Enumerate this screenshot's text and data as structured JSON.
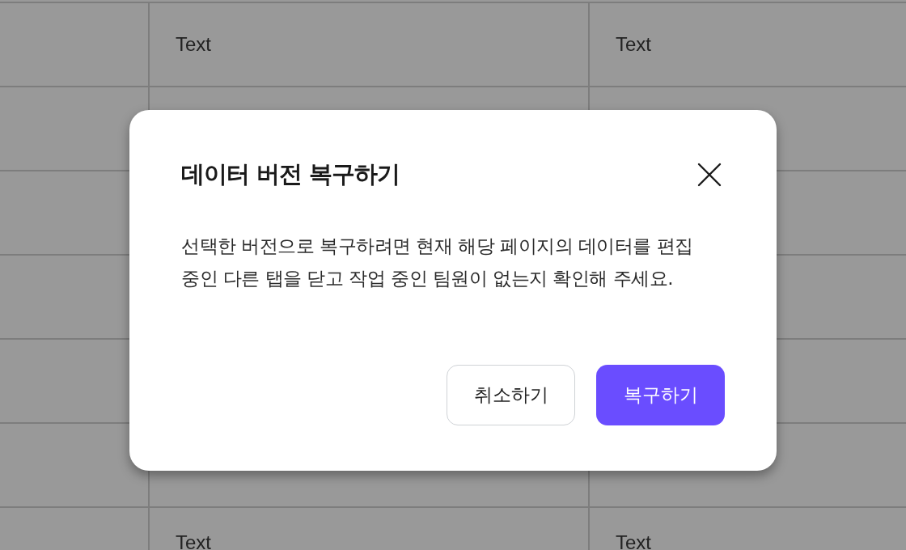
{
  "table": {
    "rows": [
      {
        "kind": "text",
        "column_2": "Text",
        "column_3": "Text"
      },
      {
        "kind": "blank"
      },
      {
        "kind": "blank"
      },
      {
        "kind": "blank"
      },
      {
        "kind": "blank"
      },
      {
        "kind": "blank"
      },
      {
        "kind": "text",
        "column_2": "Text",
        "column_3": "Text"
      }
    ]
  },
  "dialog": {
    "title": "데이터 버전 복구하기",
    "message": "선택한 버전으로 복구하려면 현재 해당 페이지의 데이터를 편집 중인 다른 탭을 닫고 작업 중인 팀원이 없는지 확인해 주세요.",
    "buttons": [
      {
        "label": "취소하기",
        "kind": "secondary"
      },
      {
        "label": "복구하기",
        "kind": "primary"
      }
    ]
  }
}
